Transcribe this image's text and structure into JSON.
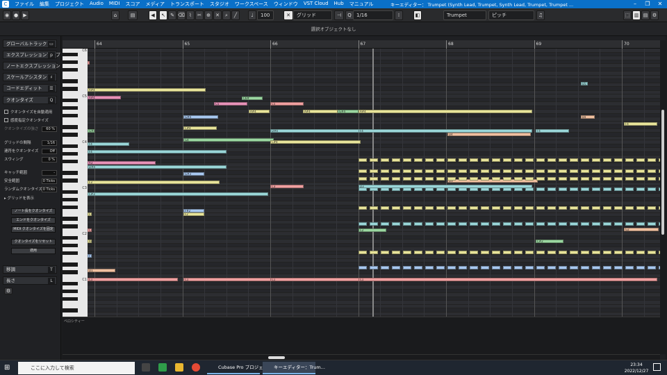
{
  "menubar": {
    "items": [
      "ファイル",
      "編集",
      "プロジェクト",
      "Audio",
      "MIDI",
      "スコア",
      "メディア",
      "トランスポート",
      "スタジオ",
      "ワークスペース",
      "ウィンドウ",
      "VST Cloud",
      "Hub",
      "マニュアル"
    ],
    "window_title": "キーエディター： Trumpet (Synth Lead, Trumpet, Synth Lead, Trumpet, Trumpet ..."
  },
  "toolbar": {
    "quantize_value": "100",
    "snap_type": "グリッド",
    "quantize_preset": "1/16",
    "track_name": "Trumpet",
    "pitch_label": "ピッチ"
  },
  "infobar": {
    "text": "選択オブジェクトなし"
  },
  "inspector": {
    "sections": [
      "グローバルトラック",
      "エクスプレッションマップ",
      "ノートエクスプレッション",
      "スケールアシスタント",
      "コードエディット",
      "クオンタイズ",
      "移調",
      "長さ"
    ],
    "quantize": {
      "auto_apply": "クオンタイズを自動適用",
      "iterative": "感度指定クオンタイズ",
      "iterative_strength_label": "クオンタイズの強さ",
      "iterative_strength": "60 %",
      "grid_label": "グリッドの間隔",
      "grid_value": "1/16",
      "tuplet_label": "連符をクオンタイズ",
      "tuplet_value": "Off",
      "swing_label": "スウィング",
      "swing_value": "0 %",
      "catch_label": "キャッチ範囲",
      "catch_value": "-",
      "safe_label": "安全範囲",
      "safe_value": "0 Ticks",
      "random_label": "ランダムクオンタイズ",
      "random_value": "0 Ticks",
      "groove_label": "グリッドを表示",
      "btn_note_end": "ノート長をクオンタイズ",
      "btn_end": "エンドをクオンタイズ",
      "btn_midi": "MIDI クオンタイズを固定",
      "btn_reset": "クオンタイズをリセット",
      "btn_apply": "適用"
    }
  },
  "ruler": {
    "bars": [
      "64",
      "65",
      "66",
      "67",
      "68",
      "69",
      "70"
    ]
  },
  "keyboard": {
    "octaves": [
      "C6",
      "C5",
      "C4",
      "C3",
      "C2",
      "C1"
    ]
  },
  "velocity_lane": {
    "label": "ベロシティー"
  },
  "notes_sample": [
    "C6#",
    "C5",
    "A#4",
    "G#4",
    "F4",
    "F4",
    "E4",
    "D#4",
    "A#3",
    "G3",
    "G#3",
    "F3",
    "C#3",
    "C#2",
    "A#1",
    "F#1",
    "D1",
    "C1"
  ],
  "taskbar": {
    "search_placeholder": "ここに入力して検索",
    "app1": "Cubase Pro プロジェ...",
    "app2": "キーエディター：Trum...",
    "time": "23:34",
    "date": "2022/12/27"
  }
}
